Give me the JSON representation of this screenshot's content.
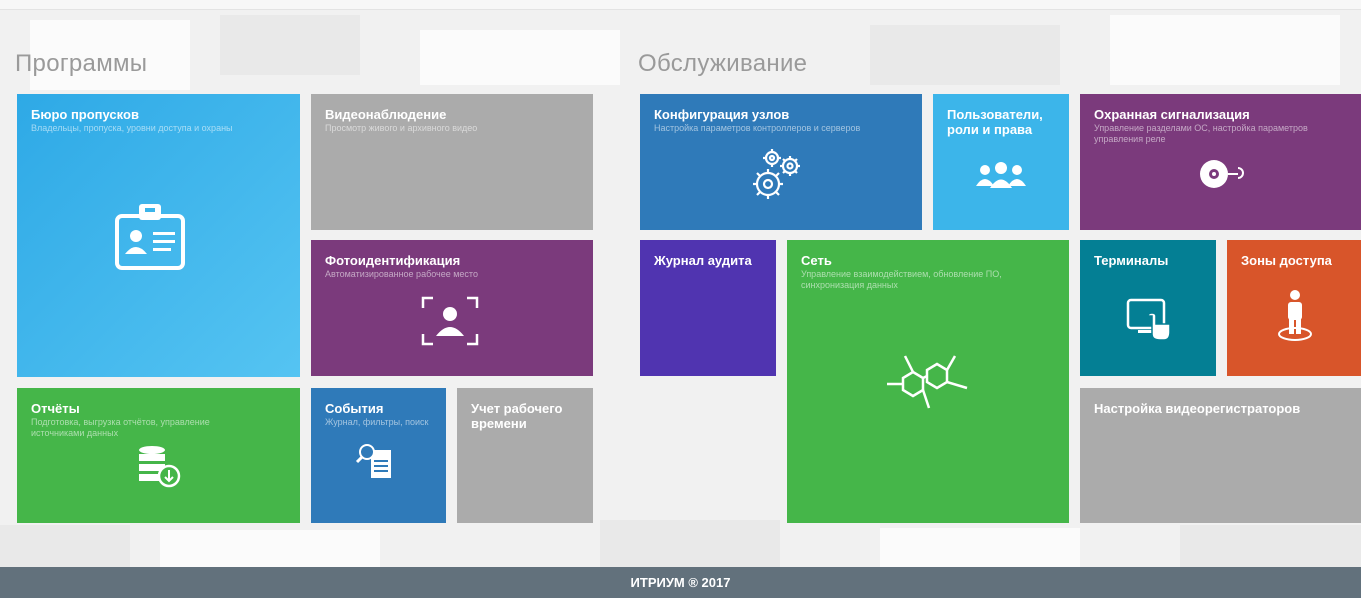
{
  "sections": {
    "programs": "Программы",
    "service": "Обслуживание"
  },
  "tiles": {
    "bureau": {
      "title": "Бюро пропусков",
      "subtitle": "Владельцы, пропуска, уровни доступа и охраны"
    },
    "video": {
      "title": "Видеонаблюдение",
      "subtitle": "Просмотр живого и архивного видео"
    },
    "photo": {
      "title": "Фотоидентификация",
      "subtitle": "Автоматизированное рабочее место"
    },
    "reports": {
      "title": "Отчёты",
      "subtitle": "Подготовка, выгрузка отчётов, управление источниками данных"
    },
    "events": {
      "title": "События",
      "subtitle": "Журнал, фильтры, поиск"
    },
    "worktime": {
      "title": "Учет рабочего времени"
    },
    "config": {
      "title": "Конфигурация узлов",
      "subtitle": "Настройка параметров контроллеров и серверов"
    },
    "users": {
      "title": "Пользователи, роли и права"
    },
    "alarm": {
      "title": "Охранная сигнализация",
      "subtitle": "Управление разделами ОС, настройка параметров управления реле"
    },
    "audit": {
      "title": "Журнал аудита"
    },
    "network": {
      "title": "Сеть",
      "subtitle": "Управление взаимодействием, обновление ПО, синхронизация данных"
    },
    "terminals": {
      "title": "Терминалы"
    },
    "zones": {
      "title": "Зоны доступа"
    },
    "dvr": {
      "title": "Настройка видеорегистраторов"
    }
  },
  "icons": {
    "bureau": "id-card-icon",
    "photo": "face-scan-icon",
    "reports": "database-export-icon",
    "events": "magnifier-document-icon",
    "config": "gears-icon",
    "users": "users-group-icon",
    "alarm": "siren-icon",
    "network": "molecule-icon",
    "terminals": "touch-terminal-icon",
    "zones": "person-zone-icon"
  },
  "colors": {
    "blue": "#3cb5ea",
    "grey": "#ababab",
    "purple": "#7b3a7c",
    "green": "#45b649",
    "navy": "#2f7ab9",
    "violet": "#5034b0",
    "teal": "#047f94",
    "orange": "#d8552a",
    "footer": "#62717c"
  },
  "footer": {
    "text": "ИТРИУМ ® 2017"
  }
}
